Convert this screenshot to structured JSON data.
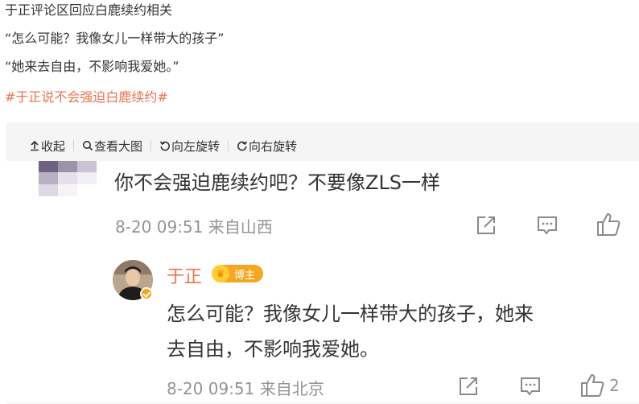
{
  "post": {
    "line1": "于正评论区回应白鹿续约相关",
    "line2": "“怎么可能？我像女儿一样带大的孩子”",
    "line3": "“她来去自由，不影响我爱她。”",
    "hashtag": "#于正说不会强迫白鹿续约#"
  },
  "toolbar": {
    "collapse": "收起",
    "view_large": "查看大图",
    "rotate_left": "向左旋转",
    "rotate_right": "向右旋转"
  },
  "comment": {
    "text": "你不会强迫鹿续约吧？不要像ZLS一样",
    "time": "8-20 09:51",
    "location": "来自山西"
  },
  "reply": {
    "username": "于正",
    "badge": "博主",
    "text_line1": "怎么可能？我像女儿一样带大的孩子，她来",
    "text_line2": "去自由，不影响我爱她。",
    "time": "8-20 09:51",
    "location": "来自北京",
    "like_count": "2"
  },
  "colors": {
    "hashtag": "#eb7350",
    "meta": "#939393",
    "badge": "#f5a623"
  },
  "icons": {
    "collapse": "arrow-up-icon",
    "view_large": "magnifier-icon",
    "rotate_left": "rotate-left-icon",
    "rotate_right": "rotate-right-icon",
    "share": "share-icon",
    "comment": "comment-icon",
    "like": "thumbs-up-icon"
  }
}
